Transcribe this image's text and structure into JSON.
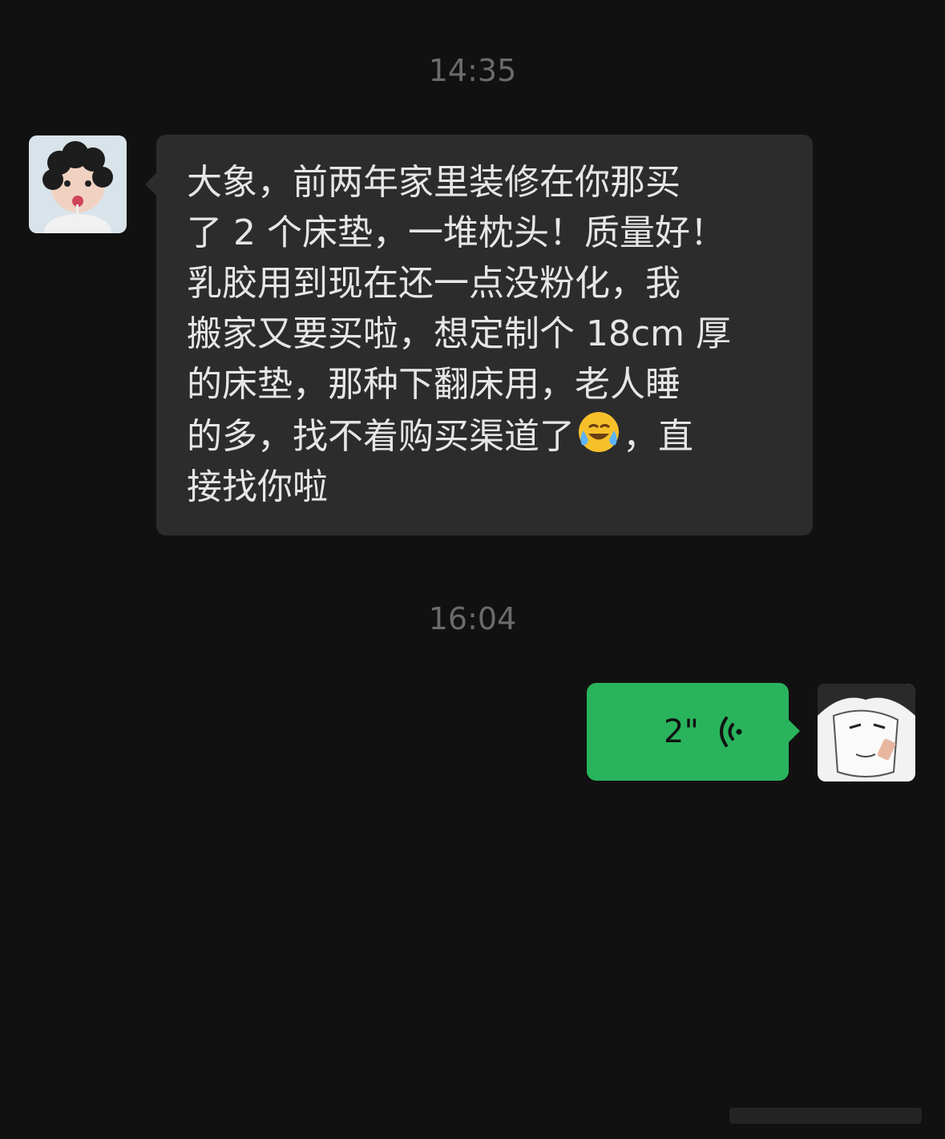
{
  "chat": {
    "timestamp_1": "14:35",
    "timestamp_2": "16:04",
    "incoming": {
      "avatar_icon": "child-avatar-photo",
      "lines": [
        "大象，前两年家里装修在你那买",
        "了 2 个床垫，一堆枕头！质量好！",
        "乳胶用到现在还一点没粉化，我",
        "搬家又要买啦，想定制个 18cm 厚",
        "的床垫，那种下翻床用，老人睡",
        "的多，找不着购买渠道了",
        "接找你啦"
      ],
      "line6_tail": "，直",
      "emoji": "face-with-tears-of-joy-emoji"
    },
    "outgoing": {
      "avatar_icon": "manga-character-avatar",
      "voice_duration": "2\"",
      "voice_icon": "voice-wave-icon"
    },
    "colors": {
      "background": "#111111",
      "incoming_bubble": "#2c2c2c",
      "outgoing_bubble": "#29b35c",
      "timestamp_text": "#6b6b6b"
    }
  }
}
